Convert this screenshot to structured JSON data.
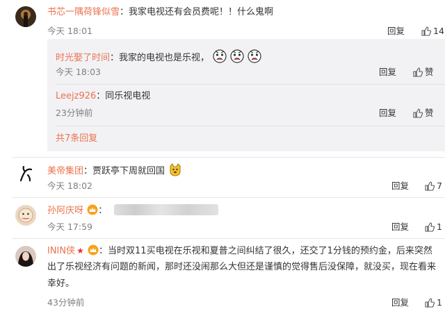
{
  "comments": [
    {
      "user": "书芯一隅荷锋似雪",
      "text": "：我家电视还有会员费呢！！什么鬼啊",
      "time": "今天 18:01",
      "reply_label": "回复",
      "like_count": "14",
      "replies": [
        {
          "user": "时光娶了时间",
          "text": "：我家的电视也是乐视，",
          "time": "今天 18:03",
          "reply_label": "回复",
          "like_label": "赞"
        },
        {
          "user": "Leejz926",
          "text": "：同乐视电视",
          "time": "23分钟前",
          "reply_label": "回复",
          "like_label": "赞"
        }
      ],
      "more_replies": "共7条回复"
    },
    {
      "user": "美帝集团",
      "text": "：贾跃亭下周就回国",
      "time": "今天 18:02",
      "reply_label": "回复",
      "like_count": "7"
    },
    {
      "user": "孙阿庆呀",
      "text": "：",
      "time": "今天 17:59",
      "reply_label": "回复",
      "like_count": "1"
    },
    {
      "user": "ININ侠",
      "text_lines": [
        "：当时双11买电视在乐视和夏普之间纠结了很久，还交了1分钱的预约金，后来突然",
        "出了乐视经济有问题的新闻，那时还没闹那么大但还是谨慎的觉得售后没保障，就没买，现在看来",
        "幸好。"
      ],
      "time": "43分钟前",
      "reply_label": "回复",
      "like_count": "1"
    }
  ],
  "colors": {
    "username": "#eb7350",
    "time": "#808080",
    "reply_bg": "#f2f2f5"
  },
  "icons": {
    "like": "thumbs-up-icon",
    "emoji_cry": "cry-face-emoji-icon",
    "emoji_doge": "doge-emoji-icon",
    "vip": "vip-crown-badge-icon",
    "star": "star-badge-icon"
  }
}
